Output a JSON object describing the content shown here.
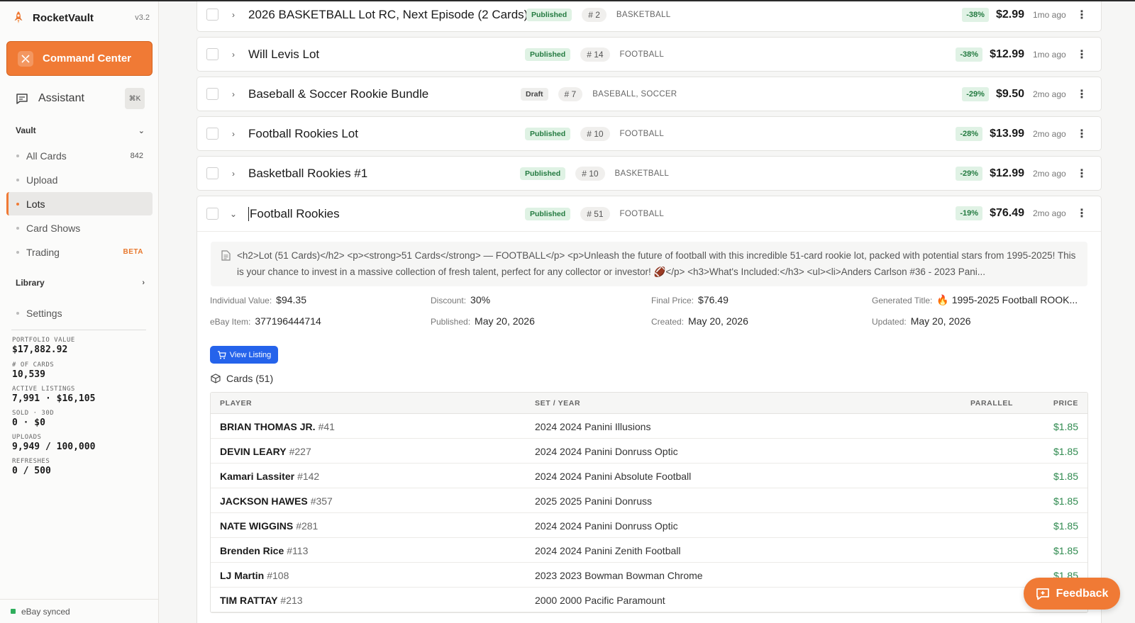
{
  "app": {
    "name": "RocketVault",
    "version": "v3.2"
  },
  "sidebar": {
    "command_center": "Command Center",
    "assistant": {
      "label": "Assistant",
      "shortcut": "⌘K"
    },
    "vault_section": "Vault",
    "items": [
      {
        "label": "All Cards",
        "count": "842"
      },
      {
        "label": "Upload"
      },
      {
        "label": "Lots",
        "active": true
      },
      {
        "label": "Card Shows"
      },
      {
        "label": "Trading",
        "badge": "BETA"
      }
    ],
    "library_section": "Library",
    "settings": "Settings",
    "stats": [
      {
        "label": "PORTFOLIO VALUE",
        "value": "$17,882.92"
      },
      {
        "label": "# OF CARDS",
        "value": "10,539"
      },
      {
        "label": "ACTIVE LISTINGS",
        "value": "7,991 · $16,105"
      },
      {
        "label": "SOLD · 30D",
        "value": "0 · $0"
      },
      {
        "label": "UPLOADS",
        "value": "9,949 / 100,000"
      },
      {
        "label": "REFRESHES",
        "value": "0 / 500"
      }
    ],
    "sync_status": "eBay synced"
  },
  "lots": [
    {
      "title": "2026 BASKETBALL Lot RC, Next Episode (2 Cards)",
      "status": "Published",
      "count": "# 2",
      "category": "BASKETBALL",
      "discount": "-38%",
      "price": "$2.99",
      "age": "1mo ago"
    },
    {
      "title": "Will Levis Lot",
      "status": "Published",
      "count": "# 14",
      "category": "FOOTBALL",
      "discount": "-38%",
      "price": "$12.99",
      "age": "1mo ago"
    },
    {
      "title": "Baseball & Soccer Rookie Bundle",
      "status": "Draft",
      "count": "# 7",
      "category": "BASEBALL, SOCCER",
      "discount": "-29%",
      "price": "$9.50",
      "age": "2mo ago"
    },
    {
      "title": "Football Rookies Lot",
      "status": "Published",
      "count": "# 10",
      "category": "FOOTBALL",
      "discount": "-28%",
      "price": "$13.99",
      "age": "2mo ago"
    },
    {
      "title": "Basketball Rookies #1",
      "status": "Published",
      "count": "# 10",
      "category": "BASKETBALL",
      "discount": "-29%",
      "price": "$12.99",
      "age": "2mo ago"
    }
  ],
  "expanded": {
    "title": "Football Rookies",
    "status": "Published",
    "count": "# 51",
    "category": "FOOTBALL",
    "discount": "-19%",
    "price": "$76.49",
    "age": "2mo ago",
    "description": "<h2>Lot (51 Cards)</h2> <p><strong>51 Cards</strong> — FOOTBALL</p> <p>Unleash the future of football with this incredible 51-card rookie lot, packed with potential stars from 1995-2025! This is your chance to invest in a massive collection of fresh talent, perfect for any collector or investor! 🏈</p> <h3>What's Included:</h3> <ul><li>Anders Carlson #36 - 2023 Pani...",
    "details": {
      "individual_value_label": "Individual Value:",
      "individual_value": "$94.35",
      "discount_label": "Discount:",
      "discount": "30%",
      "final_price_label": "Final Price:",
      "final_price": "$76.49",
      "generated_title_label": "Generated Title:",
      "generated_title": "🔥 1995-2025 Football ROOK...",
      "ebay_item_label": "eBay Item:",
      "ebay_item": "377196444714",
      "published_label": "Published:",
      "published": "May 20, 2026",
      "created_label": "Created:",
      "created": "May 20, 2026",
      "updated_label": "Updated:",
      "updated": "May 20, 2026"
    },
    "view_listing": "View Listing",
    "cards_heading": "Cards (51)",
    "table": {
      "headers": {
        "player": "PLAYER",
        "set_year": "SET / YEAR",
        "parallel": "PARALLEL",
        "price": "PRICE"
      },
      "rows": [
        {
          "player": "BRIAN THOMAS JR.",
          "num": "#41",
          "set": "2024 2024 Panini Illusions",
          "parallel": "",
          "price": "$1.85"
        },
        {
          "player": "DEVIN LEARY",
          "num": "#227",
          "set": "2024 2024 Panini Donruss Optic",
          "parallel": "",
          "price": "$1.85"
        },
        {
          "player": "Kamari Lassiter",
          "num": "#142",
          "set": "2024 2024 Panini Absolute Football",
          "parallel": "",
          "price": "$1.85"
        },
        {
          "player": "JACKSON HAWES",
          "num": "#357",
          "set": "2025 2025 Panini Donruss",
          "parallel": "",
          "price": "$1.85"
        },
        {
          "player": "NATE WIGGINS",
          "num": "#281",
          "set": "2024 2024 Panini Donruss Optic",
          "parallel": "",
          "price": "$1.85"
        },
        {
          "player": "Brenden Rice",
          "num": "#113",
          "set": "2024 2024 Panini Zenith Football",
          "parallel": "",
          "price": "$1.85"
        },
        {
          "player": "LJ Martin",
          "num": "#108",
          "set": "2023 2023 Bowman Bowman Chrome",
          "parallel": "",
          "price": "$1.85"
        },
        {
          "player": "TIM RATTAY",
          "num": "#213",
          "set": "2000 2000 Pacific Paramount",
          "parallel": "",
          "price": ""
        }
      ]
    }
  },
  "feedback": "Feedback",
  "colors": {
    "accent": "#f07a35",
    "link": "#2563eb",
    "success": "#237a40"
  }
}
